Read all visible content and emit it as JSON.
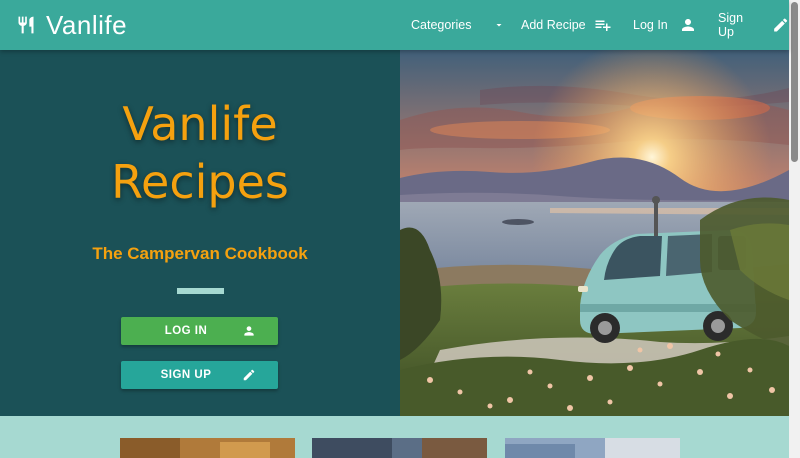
{
  "navbar": {
    "brand": "Vanlife",
    "brand_icon": "restaurant-icon",
    "links": {
      "categories": "Categories",
      "add_recipe": "Add Recipe",
      "log_in": "Log In",
      "sign_up": "Sign Up"
    }
  },
  "hero": {
    "title_line1": "Vanlife",
    "title_line2": "Recipes",
    "subtitle": "The Campervan Cookbook",
    "login_button": "LOG IN",
    "signup_button": "SIGN UP"
  },
  "colors": {
    "navbar": "#3aa99b",
    "hero_bg": "#1b5157",
    "accent": "#f5a10f",
    "login_btn": "#4caf50",
    "signup_btn": "#26a69a",
    "page_bg": "#a6d9d1"
  }
}
